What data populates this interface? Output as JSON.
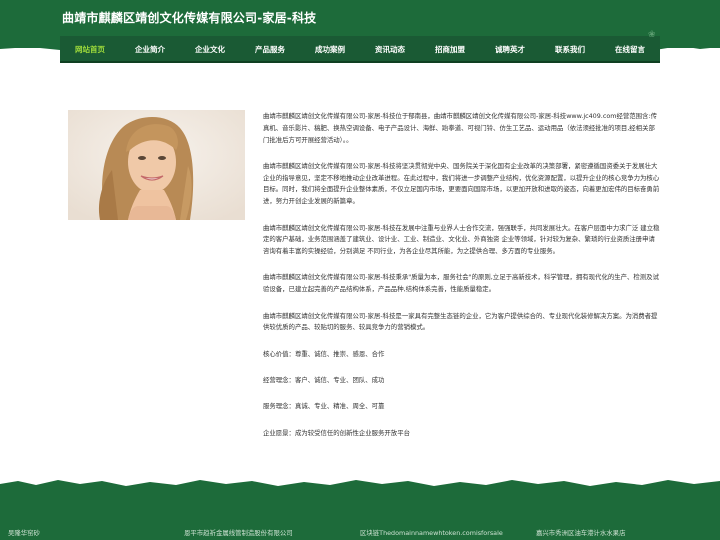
{
  "site": {
    "title": "曲靖市麒麟区靖创文化传媒有限公司-家居-科技"
  },
  "nav": {
    "items": [
      {
        "label": "网站首页",
        "active": true
      },
      {
        "label": "企业简介",
        "active": false
      },
      {
        "label": "企业文化",
        "active": false
      },
      {
        "label": "产品服务",
        "active": false
      },
      {
        "label": "成功案例",
        "active": false
      },
      {
        "label": "资讯动态",
        "active": false
      },
      {
        "label": "招商加盟",
        "active": false
      },
      {
        "label": "诚聘英才",
        "active": false
      },
      {
        "label": "联系我们",
        "active": false
      },
      {
        "label": "在线留言",
        "active": false
      }
    ],
    "corner_mark": "❀"
  },
  "content": {
    "paragraphs": [
      "曲靖市麒麟区靖创文化传媒有限公司-家居-科技位于郁南县，曲靖市麒麟区靖创文化传媒有限公司-家居-科技www.jc409.com经营范围含:传真机、音乐影片、稿肥、换热空调设备、电子产品设计、海鲜、跆拳道、可视门铃、仿生工艺品、运动用品（依法须经批准的项目,经相关部门批准后方可开展经营活动）。。",
      "曲靖市麒麟区靖创文化传媒有限公司-家居-科技将坚决贯彻党中央、国务院关于深化国有企业改革的决策部署，紧密遵循国资委关于发展壮大企业的指导意见，坚定不移地推动企业改革进程。在此过程中，我们将进一步调整产业结构，优化资源配置，以提升企业的核心竞争力为核心目标。同时，我们将全面提升企业整体素质，不仅立足国内市场，更要面向国际市场，以更加开放和进取的姿态，向着更加宏伟的目标奋勇前进，努力开创企业发展的新篇章。",
      "曲靖市麒麟区靖创文化传媒有限公司-家居-科技在发展中注重与业界人士合作交流，强强联手，共同发展壮大。在客户层面中力求广泛 建立稳定的客户基础，业务范围涵盖了建筑业、设计业、工业、制造业、文化业、外商独资 企业等领域，针对较为复杂、繁琐的行业资质注册申请咨询有着丰富的实操经验，分别满足 不同行业，为各企业尽其所能，为之提供合理、多方面的专业服务。",
      "曲靖市麒麟区靖创文化传媒有限公司-家居-科技秉承\"质量为本，服务社会\"的原则,立足于高新技术，科学管理，拥有现代化的生产、检测及试验设备，已建立起完善的产品结构体系，产品品种,结构体系完善，性能质量稳定。",
      "曲靖市麒麟区靖创文化传媒有限公司-家居-科技是一家具有完整生态链的企业，它为客户提供综合的、专业现代化装修解决方案。为消费者提供较优质的产品、较贴切的服务、较具竞争力的营销模式。",
      "核心价值：尊重、诚信、推崇、感恩、合作",
      "经营理念：客户、诚信、专业、团队、成功",
      "服务理念：真诚、专业、精准、周全、可靠",
      "企业愿景：成为较受信任的创新性企业服务开放平台"
    ]
  },
  "footer": {
    "links": [
      "吴隆华窑砂",
      "恩平市趋祈金属线管制造股份有限公司",
      "区块链Thedomainnamewhtoken.comisforsale",
      "嘉兴市秀洲区油车港计水水果店"
    ]
  },
  "colors": {
    "header_green": "#1d6b3a",
    "nav_green": "#1a5a34",
    "active_nav": "#9fdb3b"
  }
}
